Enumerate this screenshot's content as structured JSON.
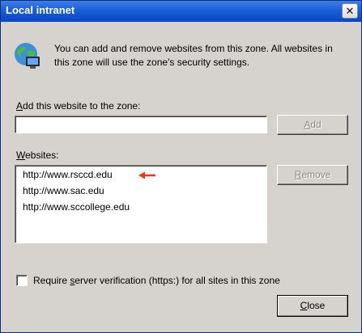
{
  "window": {
    "title": "Local intranet",
    "close_glyph": "✕"
  },
  "intro_text": "You can add and remove websites from this zone. All websites in this zone will use the zone's security settings.",
  "add_section": {
    "label_accel": "A",
    "label_rest": "dd this website to the zone:",
    "input_value": "",
    "add_button_accel": "A",
    "add_button_rest": "dd"
  },
  "websites_section": {
    "label_accel": "W",
    "label_rest": "ebsites:",
    "items": [
      "http://www.rsccd.edu",
      "http://www.sac.edu",
      "http://www.sccollege.edu"
    ],
    "remove_button_accel": "R",
    "remove_button_rest": "emove"
  },
  "verification": {
    "checked": false,
    "label_before": "Require ",
    "label_accel": "s",
    "label_after": "erver verification (https:) for all sites in this zone"
  },
  "close_button": {
    "accel": "C",
    "rest": "lose"
  },
  "colors": {
    "titlebar": "#1b5ed8",
    "dialog_bg": "#d6d3ce",
    "annotation_arrow": "#e8381c"
  },
  "icons": {
    "zone": "local-intranet-globe-icon",
    "annotation": "red-arrow-icon"
  }
}
